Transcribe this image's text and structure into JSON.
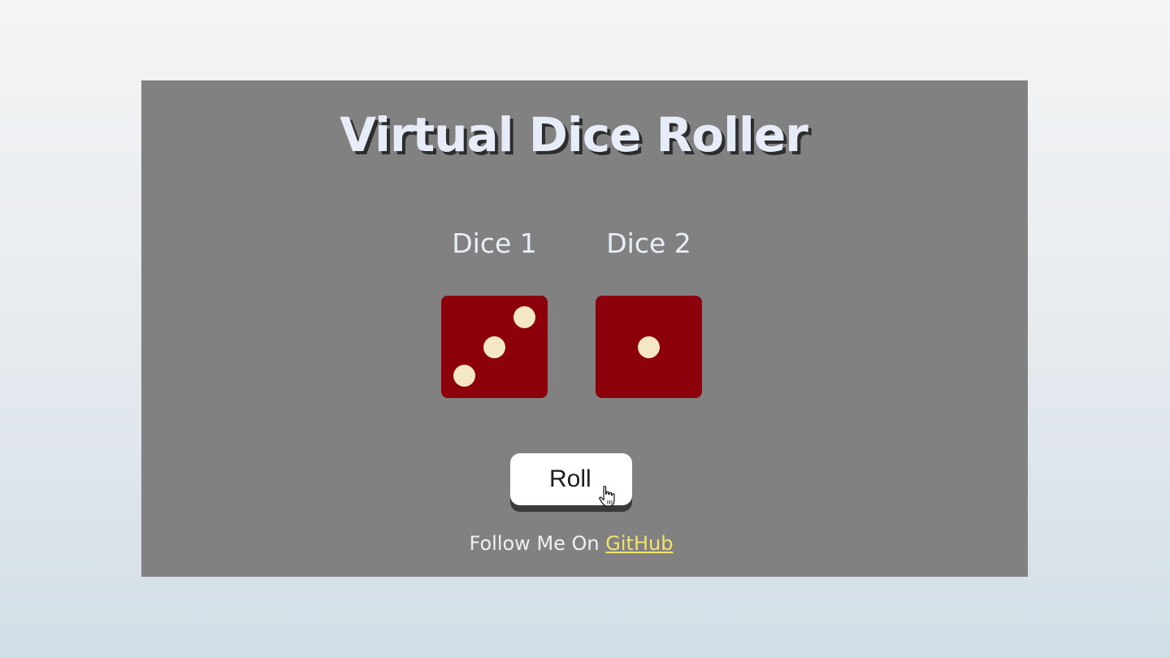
{
  "title": "Virtual Dice Roller",
  "dice": [
    {
      "label": "Dice 1",
      "value": 3
    },
    {
      "label": "Dice 2",
      "value": 1
    }
  ],
  "roll_button": {
    "label": "Roll"
  },
  "footer": {
    "text": "Follow Me On ",
    "link_text": "GitHub"
  },
  "colors": {
    "frame_background": "#818181",
    "die_face": "#8b000a",
    "pip": "#f6e7c4",
    "title_text": "#e7edf8",
    "link": "#f2e36b"
  },
  "icons": {
    "cursor": "hand-pointer-icon"
  }
}
